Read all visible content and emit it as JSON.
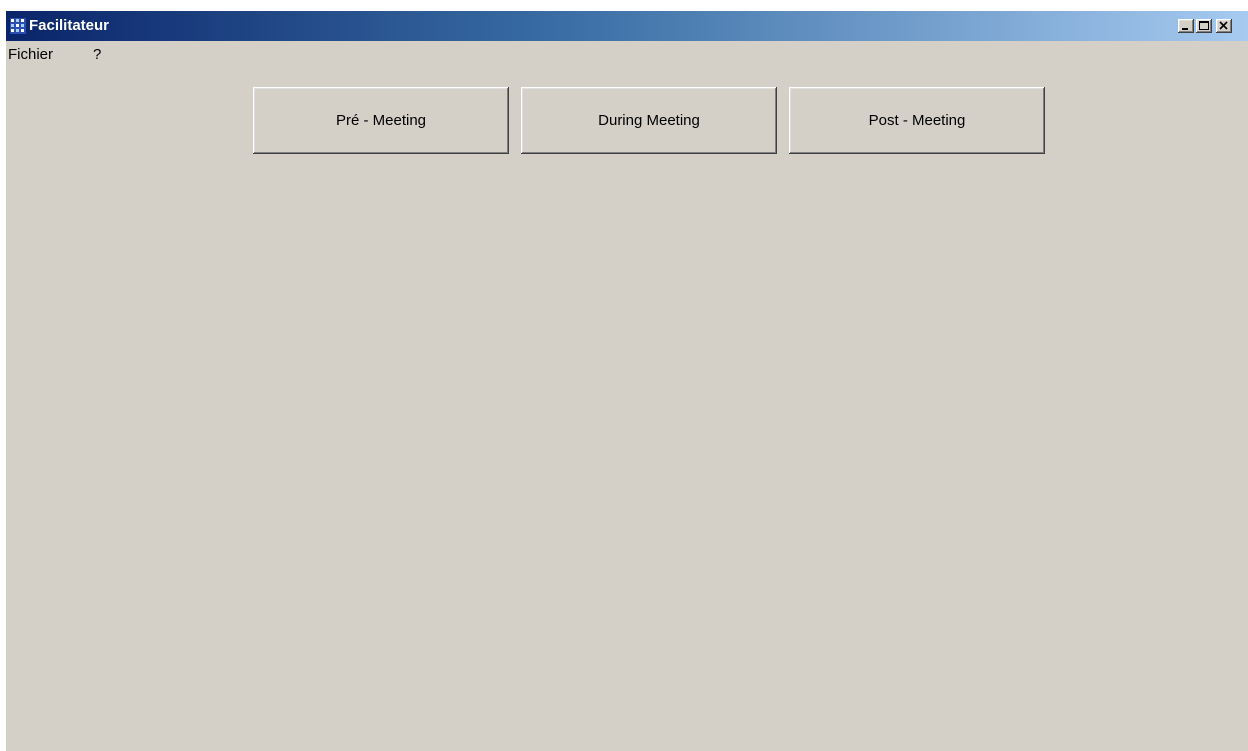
{
  "window": {
    "title": "Facilitateur",
    "icon": "app-grid-icon",
    "controls": [
      "minimize-icon",
      "maximize-icon",
      "close-icon"
    ]
  },
  "menu": {
    "items": [
      {
        "label": "Fichier"
      },
      {
        "label": "?"
      }
    ]
  },
  "main": {
    "buttons": [
      {
        "label": "Pré - Meeting"
      },
      {
        "label": "During  Meeting"
      },
      {
        "label": "Post - Meeting"
      }
    ]
  },
  "colors": {
    "face": "#d4d0c8",
    "title_start": "#0a246a",
    "title_end": "#a6caf0"
  }
}
